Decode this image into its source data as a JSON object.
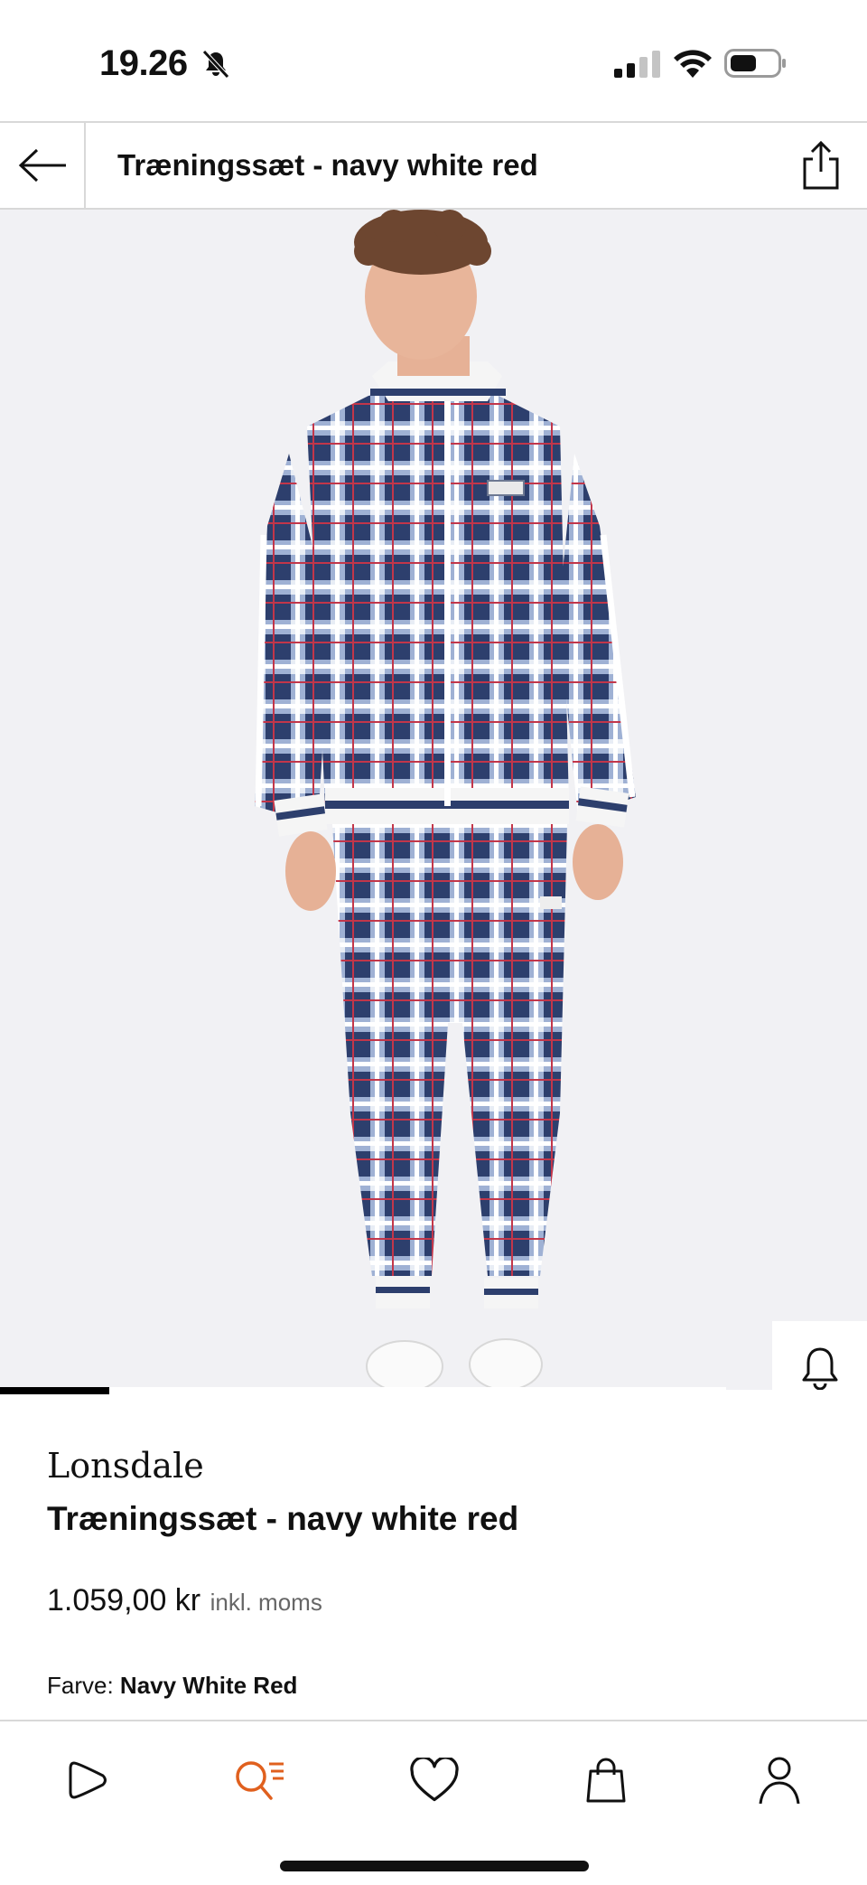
{
  "status_bar": {
    "time": "19.26"
  },
  "header": {
    "title": "Træningssæt - navy white red"
  },
  "product": {
    "brand": "Lonsdale",
    "name": "Træningssæt - navy white red",
    "price": "1.059,00 kr",
    "vat_note": "inkl. moms",
    "color_label": "Farve:",
    "color_value": "Navy White Red"
  },
  "carousel": {
    "progress_fraction": 0.15
  },
  "colors": {
    "accent": "#e0601e",
    "navy": "#2c3f6e",
    "image_bg": "#f1f1f4",
    "divider": "#d8d8d8"
  },
  "icons": {
    "status": [
      "bell-slash-icon",
      "cellular-signal-icon",
      "wifi-icon",
      "battery-icon"
    ],
    "header": [
      "arrow-left-icon",
      "share-icon"
    ],
    "side_actions": [
      "bell-icon",
      "heart-icon",
      "shopping-bag-icon"
    ],
    "bottom_nav": [
      "play-home-icon",
      "search-list-icon",
      "heart-icon",
      "shopping-bag-icon",
      "user-icon"
    ],
    "active_nav": "search-list-icon"
  }
}
